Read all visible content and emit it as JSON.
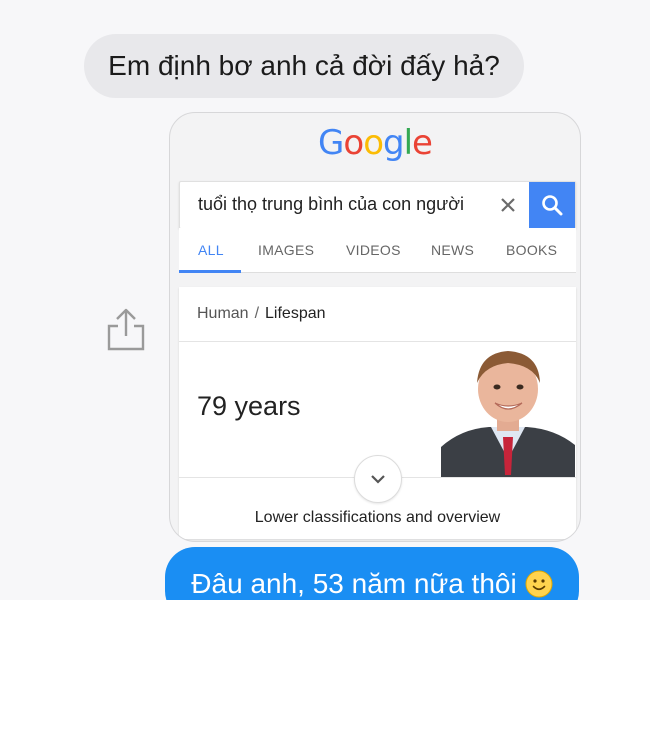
{
  "chat": {
    "incoming_message": "Em định bơ anh cả đời đấy hả?",
    "outgoing_message": "Đâu anh, 53 năm nữa thôi"
  },
  "google_card": {
    "logo": [
      "G",
      "o",
      "o",
      "g",
      "l",
      "e"
    ],
    "logo_colors": [
      "#4285f4",
      "#ea4335",
      "#fbbc05",
      "#4285f4",
      "#34a853",
      "#ea4335"
    ],
    "search_query": "tuổi thọ trung bình của con người",
    "tabs": [
      {
        "label": "ALL",
        "active": true
      },
      {
        "label": "IMAGES",
        "active": false
      },
      {
        "label": "VIDEOS",
        "active": false
      },
      {
        "label": "NEWS",
        "active": false
      },
      {
        "label": "BOOKS",
        "active": false
      }
    ],
    "breadcrumb": {
      "parent": "Human",
      "separator": "/",
      "current": "Lifespan"
    },
    "answer": "79 years",
    "more_label": "Lower classifications and overview",
    "accent_color": "#4285f4"
  },
  "colors": {
    "incoming_bubble": "#e8e8eb",
    "outgoing_bubble": "#1a8ef3"
  },
  "icons": {
    "share": "share-icon",
    "clear": "close-icon",
    "search": "search-icon",
    "expand": "chevron-down-icon",
    "emoji": "smile-emoji-icon",
    "portrait": "person-photo"
  }
}
